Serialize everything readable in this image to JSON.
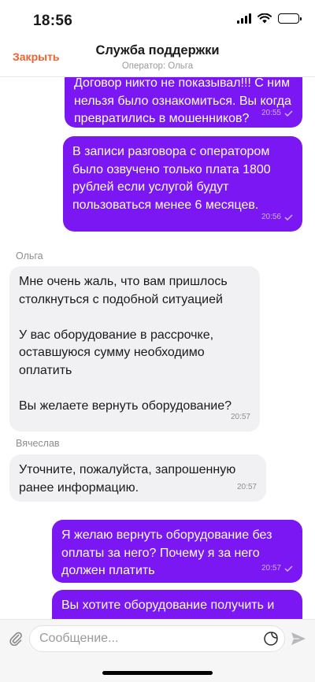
{
  "status": {
    "time": "18:56"
  },
  "header": {
    "close_label": "Закрыть",
    "title": "Служба поддержки",
    "subtitle": "Оператор: Ольга"
  },
  "messages": [
    {
      "direction": "out",
      "text": "Договор никто не показывал!!! С ним нельзя было ознакомиться. Вы когда превратились в мошенников?",
      "time": "20:55",
      "read": true
    },
    {
      "direction": "out",
      "text": "В записи разговора с оператором было озвучено только плата 1800 рублей если услугой будут пользоваться менее 6 месяцев.",
      "time": "20:56",
      "read": true
    },
    {
      "direction": "in",
      "sender": "Ольга",
      "text": "Мне очень жаль, что вам пришлось столкнуться с подобной ситуацией\n\nУ вас оборудование в рассрочке, оставшуюся сумму необходимо оплатить\n\nВы желаете вернуть оборудование?",
      "time": "20:57"
    },
    {
      "direction": "in",
      "sender": "Вячеслав",
      "text": "Уточните, пожалуйста, запрошенную ранее информацию.",
      "time": "20:57"
    },
    {
      "direction": "out",
      "text": "Я желаю вернуть оборудование без оплаты за него? Почему я за него должен платить",
      "time": "20:57",
      "read": true
    },
    {
      "direction": "out",
      "text": "Вы хотите оборудование получить и",
      "time": "",
      "read": false
    }
  ],
  "composer": {
    "placeholder": "Сообщение...",
    "attach_icon": "paperclip-icon",
    "sticker_icon": "sticker-icon",
    "send_icon": "send-icon"
  },
  "colors": {
    "accent": "#f0622f",
    "outgoing_bubble": "#7b17f2",
    "incoming_bubble": "#f1f1f3"
  }
}
